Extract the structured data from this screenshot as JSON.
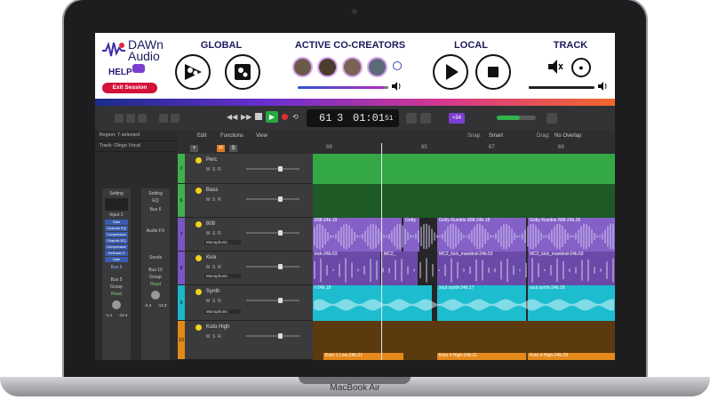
{
  "device": {
    "brand_label": "MacBook Air"
  },
  "plugin": {
    "logo_line1": "DAWn",
    "logo_line2": "Audio",
    "help_label": "HELP",
    "exit_label": "Exit Session",
    "global_title": "GLOBAL",
    "cocreators_title": "ACTIVE CO-CREATORS",
    "local_title": "LOCAL",
    "track_title": "TRACK",
    "master_volume": 0.95,
    "track_volume": 0.9
  },
  "transport": {
    "bar": "61",
    "beat": "3",
    "time": "01:01",
    "time_sub": "51",
    "tempo_badge": "≈34"
  },
  "inspector": {
    "region_label": "Region: 7 selected",
    "track_label": "Track: Olego Vocal",
    "strip1": {
      "setting": "Setting",
      "eq": "",
      "input": "Input 2",
      "plugins": [
        "Gain",
        "Channel EQ",
        "Compressor",
        "Graphic EQ",
        "Compressor",
        "DeEsser 2",
        "Gain"
      ],
      "send": "Bus 6",
      "bus": "Bus 5",
      "group": "Group",
      "auto": "Read",
      "vals": [
        "-1.1",
        "-12.4"
      ]
    },
    "strip2": {
      "setting": "Setting",
      "eq": "EQ",
      "input": "Bus 6",
      "plugins": [
        "Audio FX"
      ],
      "send": "Sends",
      "bus": "Bus 10",
      "group": "Group",
      "auto": "Read",
      "vals": [
        "-2.4",
        "-12.3"
      ]
    }
  },
  "daw_menus": {
    "edit": "Edit",
    "functions": "Functions",
    "view": "View",
    "snap_label": "Snap:",
    "snap_value": "Smart",
    "drag_label": "Drag:",
    "drag_value": "No Overlap"
  },
  "ruler": [
    "69",
    "65",
    "67",
    "69"
  ],
  "tracks": [
    {
      "num": "2",
      "name": "Perc",
      "color": "#3fb24b",
      "mode": ""
    },
    {
      "num": "6",
      "name": "Bass",
      "color": "#3fb24b",
      "mode": ""
    },
    {
      "num": "7",
      "name": "808",
      "color": "#7a55c4",
      "mode": "Monophonic"
    },
    {
      "num": "8",
      "name": "Kick",
      "color": "#7a55c4",
      "mode": "Monophonic"
    },
    {
      "num": "9",
      "name": "Synth",
      "color": "#19b7c9",
      "mode": "Monophonic"
    },
    {
      "num": "10",
      "name": "Koto High",
      "color": "#e08a16",
      "mode": ""
    }
  ],
  "track_buttons": {
    "m": "M",
    "s": "S",
    "r": "R"
  },
  "regions": {
    "r808a": "808-24b.19",
    "r808b": "Gritty",
    "r808c": "Gritty Rumble 808-24b.18",
    "r808d": "Gritty Rumble 808-24b.26",
    "kicka": "kick-24b.63",
    "kickb": "MC2_",
    "kickc": "MC2_kick_mankind-24b.53",
    "kickd": "MC2_kick_mankind-24b.59",
    "synth_a": "t-24b.18",
    "synth_b": "soul synth-24b.17",
    "synth_c": "soul synth-24b.18",
    "koto_a": "Koto 1 Low-24b.21",
    "koto_b": "Koto 4 High-24b.21",
    "koto_c": "Koto 4 High-24b.29"
  }
}
